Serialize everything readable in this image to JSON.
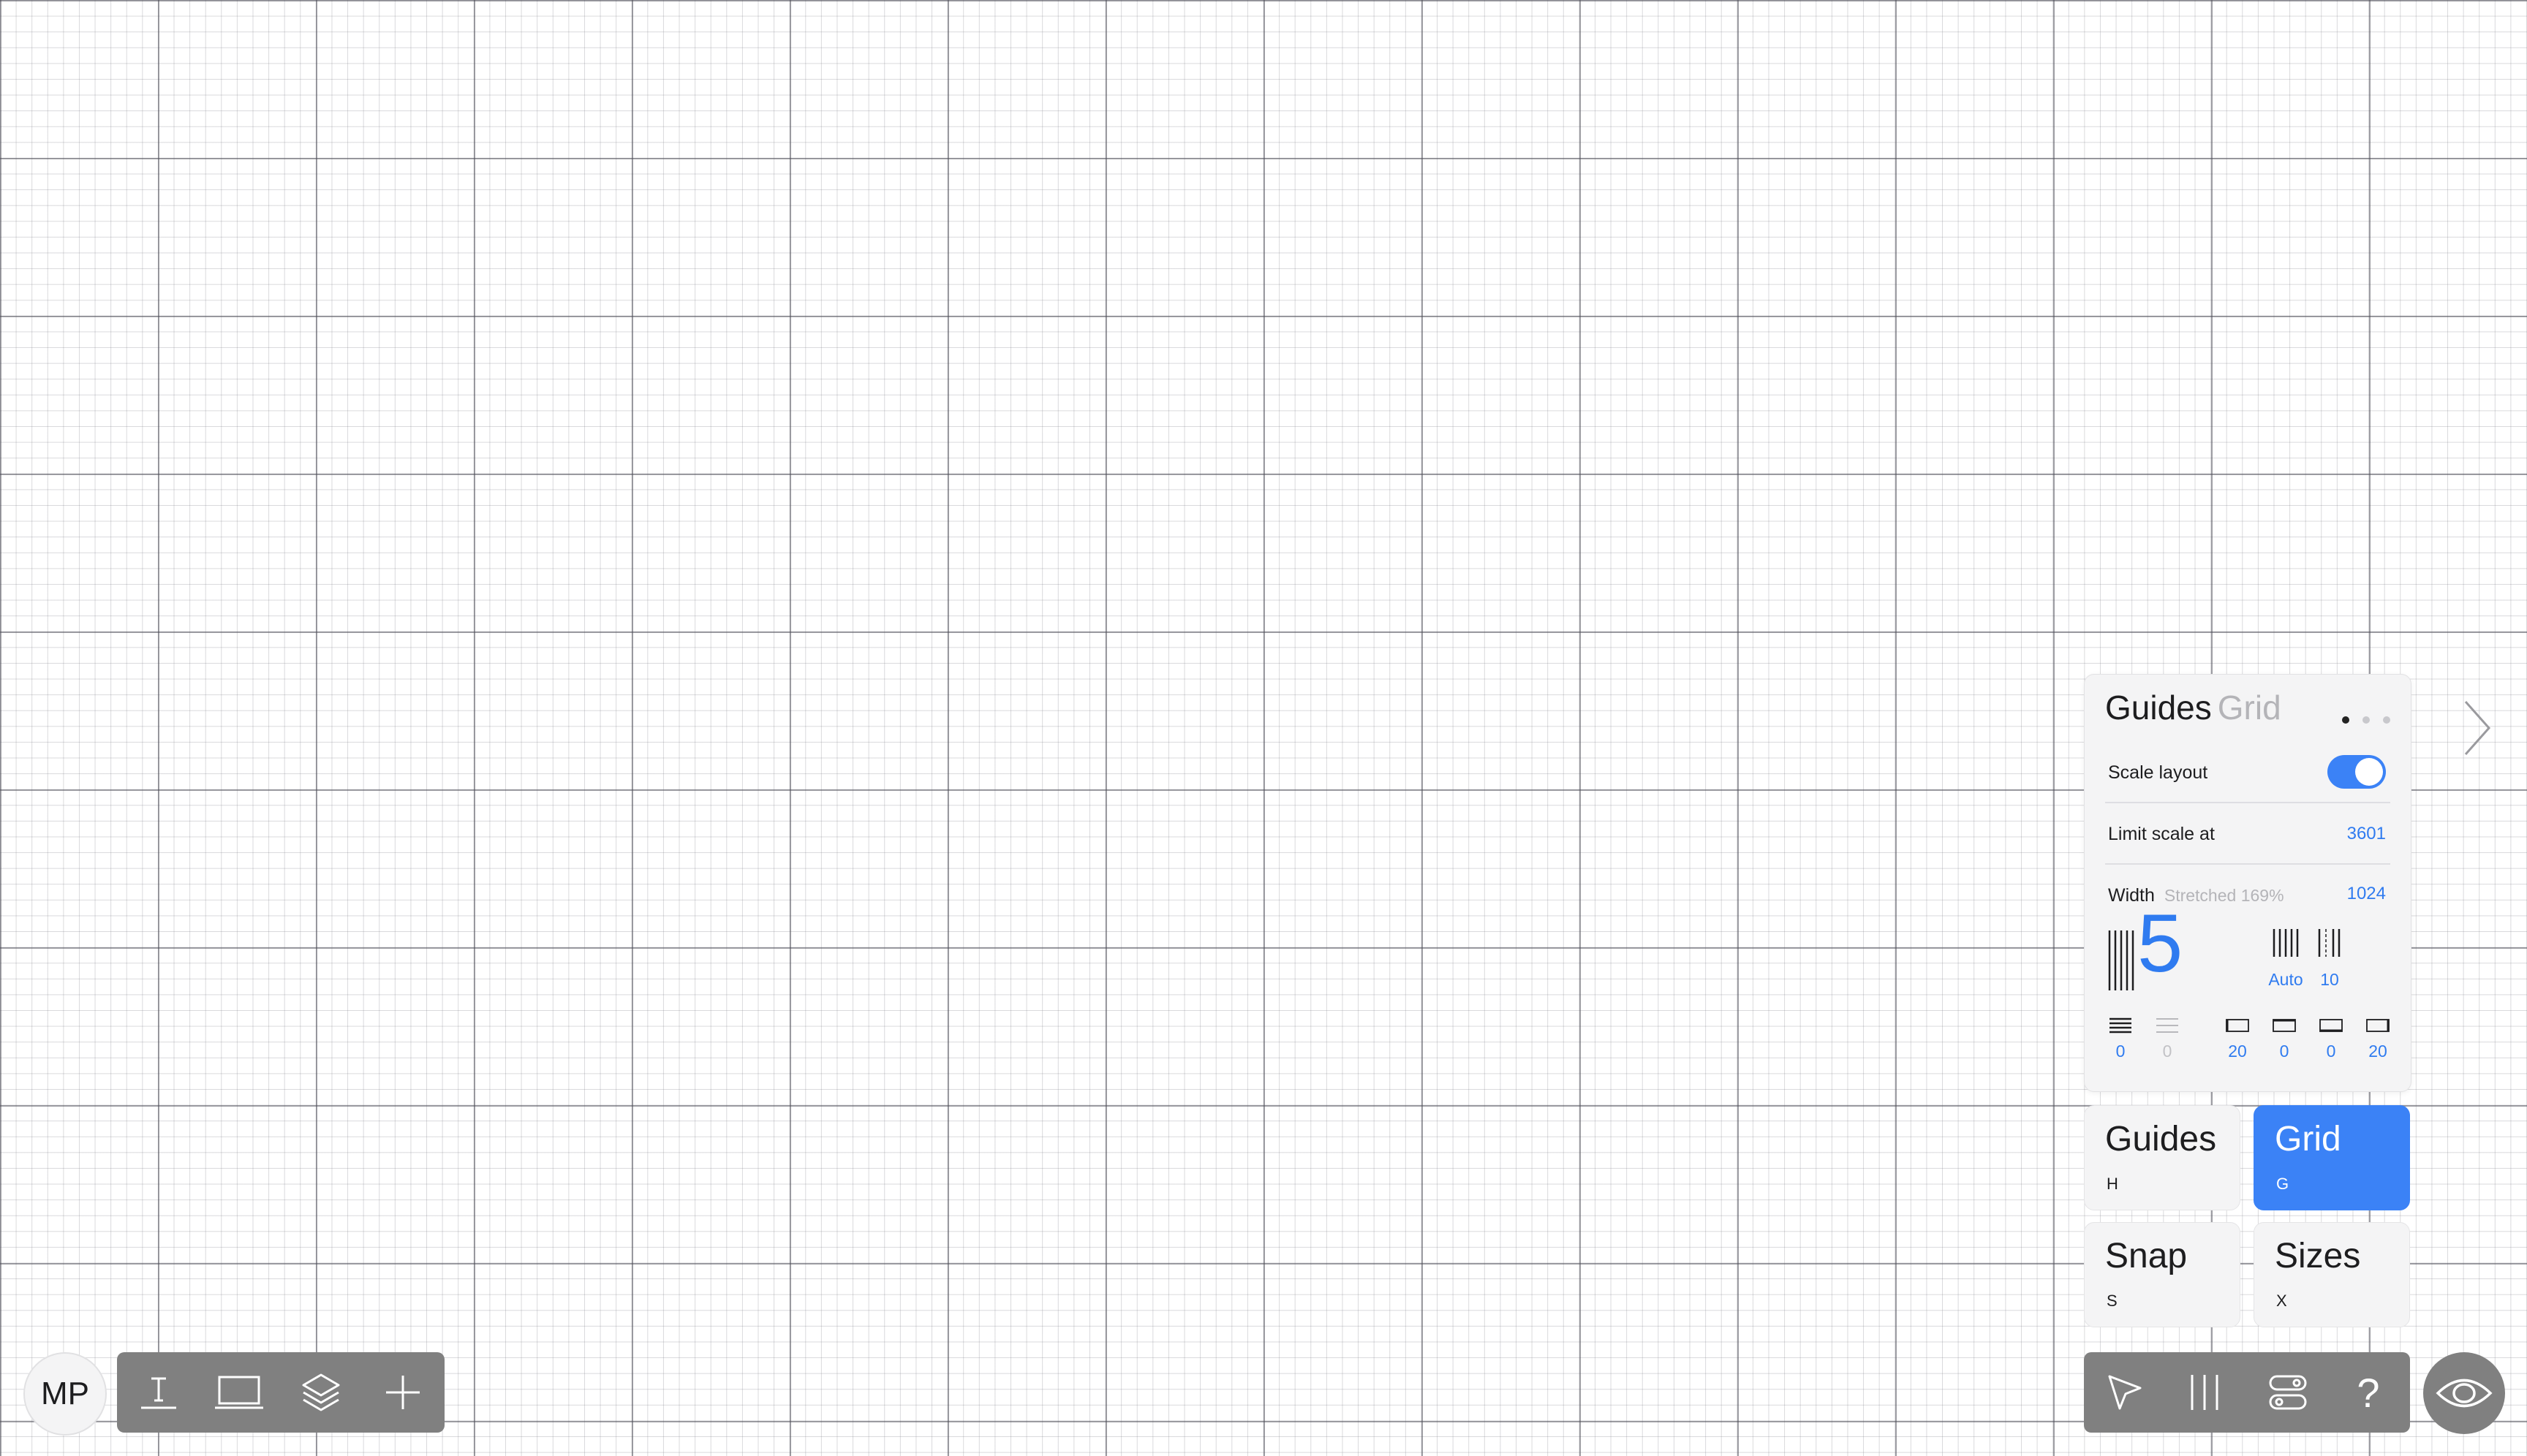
{
  "panel": {
    "title_active": "Guides",
    "title_inactive": "Grid",
    "page_dots": 3,
    "scale_layout_label": "Scale layout",
    "scale_layout_on": true,
    "limit_label": "Limit scale at",
    "limit_value": "3601",
    "width_label": "Width",
    "width_note": "Stretched 169%",
    "width_value": "1024",
    "columns": "5",
    "column_mode_auto": "Auto",
    "column_gutter": "10",
    "rows_value": "0",
    "rows_gutter": "0",
    "margin_left": "20",
    "margin_top": "0",
    "margin_bottom": "0",
    "margin_right": "20"
  },
  "tiles": {
    "guides": {
      "label": "Guides",
      "key": "H"
    },
    "grid": {
      "label": "Grid",
      "key": "G"
    },
    "snap": {
      "label": "Snap",
      "key": "S"
    },
    "sizes": {
      "label": "Sizes",
      "key": "X"
    }
  },
  "avatar": {
    "initials": "MP"
  },
  "left_toolbar": [
    "text-baseline-icon",
    "laptop-icon",
    "layers-icon",
    "plus-icon"
  ],
  "right_toolbar": [
    "cursor-icon",
    "columns-icon",
    "toggles-icon",
    "help-icon"
  ],
  "help_glyph": "?",
  "colors": {
    "accent": "#3b82f6",
    "toolbar": "#808080"
  }
}
